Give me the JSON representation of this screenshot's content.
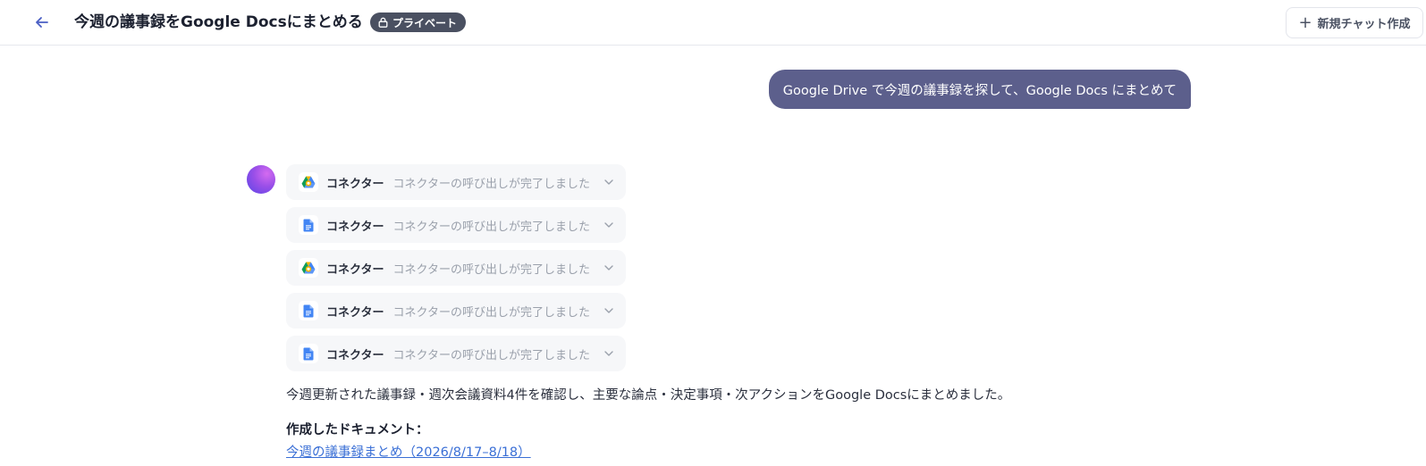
{
  "header": {
    "title": "今週の議事録をGoogle Docsにまとめる",
    "private_badge": "プライベート",
    "new_chat_label": "新規チャット作成",
    "back_icon": "arrow-left-icon",
    "lock_icon": "lock-icon",
    "plus_icon": "plus-icon"
  },
  "user_message": {
    "text": "Google Drive で今週の議事録を探して、Google Docs にまとめて",
    "bubble_color": "#5c5f8c"
  },
  "assistant": {
    "connectors": [
      {
        "icon": "google-drive-icon",
        "label": "コネクター",
        "status": "コネクターの呼び出しが完了しました"
      },
      {
        "icon": "google-docs-icon",
        "label": "コネクター",
        "status": "コネクターの呼び出しが完了しました"
      },
      {
        "icon": "google-drive-icon",
        "label": "コネクター",
        "status": "コネクターの呼び出しが完了しました"
      },
      {
        "icon": "google-docs-icon",
        "label": "コネクター",
        "status": "コネクターの呼び出しが完了しました"
      },
      {
        "icon": "google-docs-icon",
        "label": "コネクター",
        "status": "コネクターの呼び出しが完了しました"
      }
    ],
    "reply": "今週更新された議事録・週次会議資料4件を確認し、主要な論点・決定事項・次アクションをGoogle Docsにまとめました。",
    "created_heading": "作成したドキュメント：",
    "doc_link": "今週の議事録まとめ（2026/8/17–8/18）",
    "link_color": "#3a6fd6"
  }
}
